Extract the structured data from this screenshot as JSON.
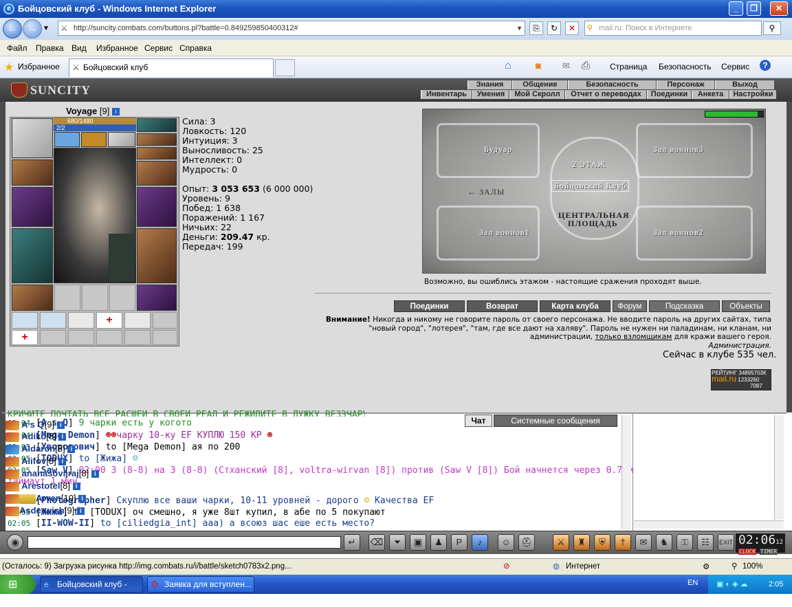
{
  "window": {
    "title": "Бойцовский клуб - Windows Internet Explorer"
  },
  "browser": {
    "url": "http://suncity.combats.com/buttons.pl?battle=0.849259850400312#",
    "search_placeholder": "mail.ru: Поиск в Интернете",
    "menu": [
      "Файл",
      "Правка",
      "Вид",
      "Избранное",
      "Сервис",
      "Справка"
    ],
    "favorites_label": "Избранное",
    "tab_title": "Бойцовский клуб",
    "commands": [
      "Страница",
      "Безопасность",
      "Сервис"
    ]
  },
  "game": {
    "logo": "SUNCITY",
    "top_nav": [
      "Знания",
      "Общение",
      "Безопасность",
      "Персонаж",
      "Выход"
    ],
    "sub_nav": [
      "Инвентарь",
      "Умения",
      "Мой Скролл",
      "Отчет о переводах",
      "Поединки",
      "Анкета",
      "Настройки"
    ],
    "character": {
      "name": "Voyage",
      "level": "[9]",
      "hp": "680/1480",
      "mp": "2/2"
    },
    "stats": [
      "Сила: 3",
      "Ловкость: 120",
      "Интуиция: 3",
      "Выносливость: 25",
      "Интеллект: 0",
      "Мудрость: 0"
    ],
    "info": {
      "exp_label": "Опыт:",
      "exp": "3 053 653",
      "exp_next": "(6 000 000)",
      "level": "Уровень: 9",
      "wins": "Побед: 1 638",
      "losses": "Поражений: 1 167",
      "draws": "Ничьих: 22",
      "money_label": "Деньги:",
      "money": "209.47",
      "money_unit": "кр.",
      "transfers": "Передач: 199"
    },
    "map": {
      "rooms": [
        "Будуар",
        "Зал воинов3",
        "2 ЭТАЖ",
        "Бойцовский Клуб",
        "ЗАЛЫ",
        "ЦЕНТРАЛЬНАЯ",
        "ПЛОЩАДЬ",
        "Зал воинов1",
        "Зал воинов2"
      ],
      "caption": "Возможно, вы ошиблись этажом - настоящие сражения проходят выше.",
      "arrow": "←"
    },
    "buttons": [
      "Поединки",
      "Возврат",
      "Карта клуба",
      "Форум",
      "Подсказка",
      "Объекты"
    ],
    "warning": {
      "bold": "Внимание!",
      "text": "Никогда и никому не говорите пароль от своего персонажа. Не вводите пароль на других сайтах, типа \"новый город\", \"лотерея\", \"там, где все дают на халяву\". Пароль не нужен ни паладинам, ни кланам, ни администрации,",
      "link": "только взломщикам",
      "tail": "для кражи вашего героя.",
      "sign": "Администрация."
    },
    "online": "Сейчас в клубе 535 чел.",
    "rating": {
      "label": "РЕЙТИНГ",
      "num1": "34895703К",
      "brand": "mail.ru",
      "num2": "1233260",
      "num3": "7087"
    }
  },
  "chat": {
    "tabs": [
      "Чат",
      "Системные сообщения"
    ],
    "cut_line": "КРИЧИТЕ ПОЧТАТЬ ВСЕ РАСШЕЙ В СВОЕЙ РЕАЛ И РЕЖИДИТЕ В ЛУЖКУ ВЕЗЭЧАРУ",
    "lines": [
      {
        "time": "02:04",
        "nick": "A s Q",
        "text": "9 чарки есть у когото",
        "color": "#2a8a2a"
      },
      {
        "time": "02:04",
        "nick": "Mega Demon",
        "text": "чарку 10-ку EF КУПЛЮ 150 КР",
        "color": "#9a2a9a"
      },
      {
        "time": "02:05",
        "nick": "Уворотович",
        "text": "to [Mega Demon] ая по 200",
        "color": "#000"
      },
      {
        "time": "02:05",
        "nick": "TODUX",
        "text": "to [Жижа]",
        "color": "#1a3b8c"
      },
      {
        "time": "02:05",
        "nick": "Saw V",
        "text": "02:00 3 (8-8) на 3 (8-8) (Стханский [8], voltra-wirvan [8]) против (Saw V [8]) Бой начнется через 0.7 мин.,",
        "color": "#c03ac0"
      },
      {
        "time": "",
        "nick": "",
        "text": "таймаут 1 мин.",
        "color": "#c03ac0"
      },
      {
        "time": "02:05",
        "nick": "Photographer",
        "text": "Скуплю все ваши чарки, 10-11 уровней - дорого",
        "color": "#1a3b8c"
      },
      {
        "time": "",
        "nick": "",
        "text": "Качества EF",
        "color": "#1a3b8c"
      },
      {
        "time": "02:05",
        "nick": "Жижа",
        "text": "to [TODUX] оч смешно, я уже 8шт купил, в абе по 5 покупают",
        "color": "#000"
      },
      {
        "time": "02:05",
        "nick": "II-WOW-II",
        "text": "to [ciliedgia_int] ааа) а всоюз шас еше есть место?",
        "color": "#1a3b8c"
      }
    ]
  },
  "users": [
    {
      "name": "A s Q",
      "level": "[9]"
    },
    {
      "name": "Adiko",
      "level": "[8]"
    },
    {
      "name": "Aldaron",
      "level": "[8]"
    },
    {
      "name": "Alifov",
      "level": "[8]"
    },
    {
      "name": "ananasovijraj",
      "level": "[8]"
    },
    {
      "name": "Arestotel",
      "level": "[8]"
    },
    {
      "name": "Arven",
      "level": "[10]"
    },
    {
      "name": "Asderwish",
      "level": "[9]"
    }
  ],
  "clock": {
    "time": "02:06",
    "sec": "12",
    "clock_label": "CLOCK",
    "timer_label": "TIMER",
    "exit": "EXIT"
  },
  "statusbar": {
    "text": "(Осталось: 9) Загрузка рисунка http://img.combats.ru/i/battle/sketch0783x2.png...",
    "zone": "Интернет",
    "zoom": "100%"
  },
  "taskbar": {
    "tasks": [
      "Бойцовский клуб - Wi...",
      "Заявка для вступлен..."
    ],
    "lang": "EN",
    "time": "2:05"
  }
}
